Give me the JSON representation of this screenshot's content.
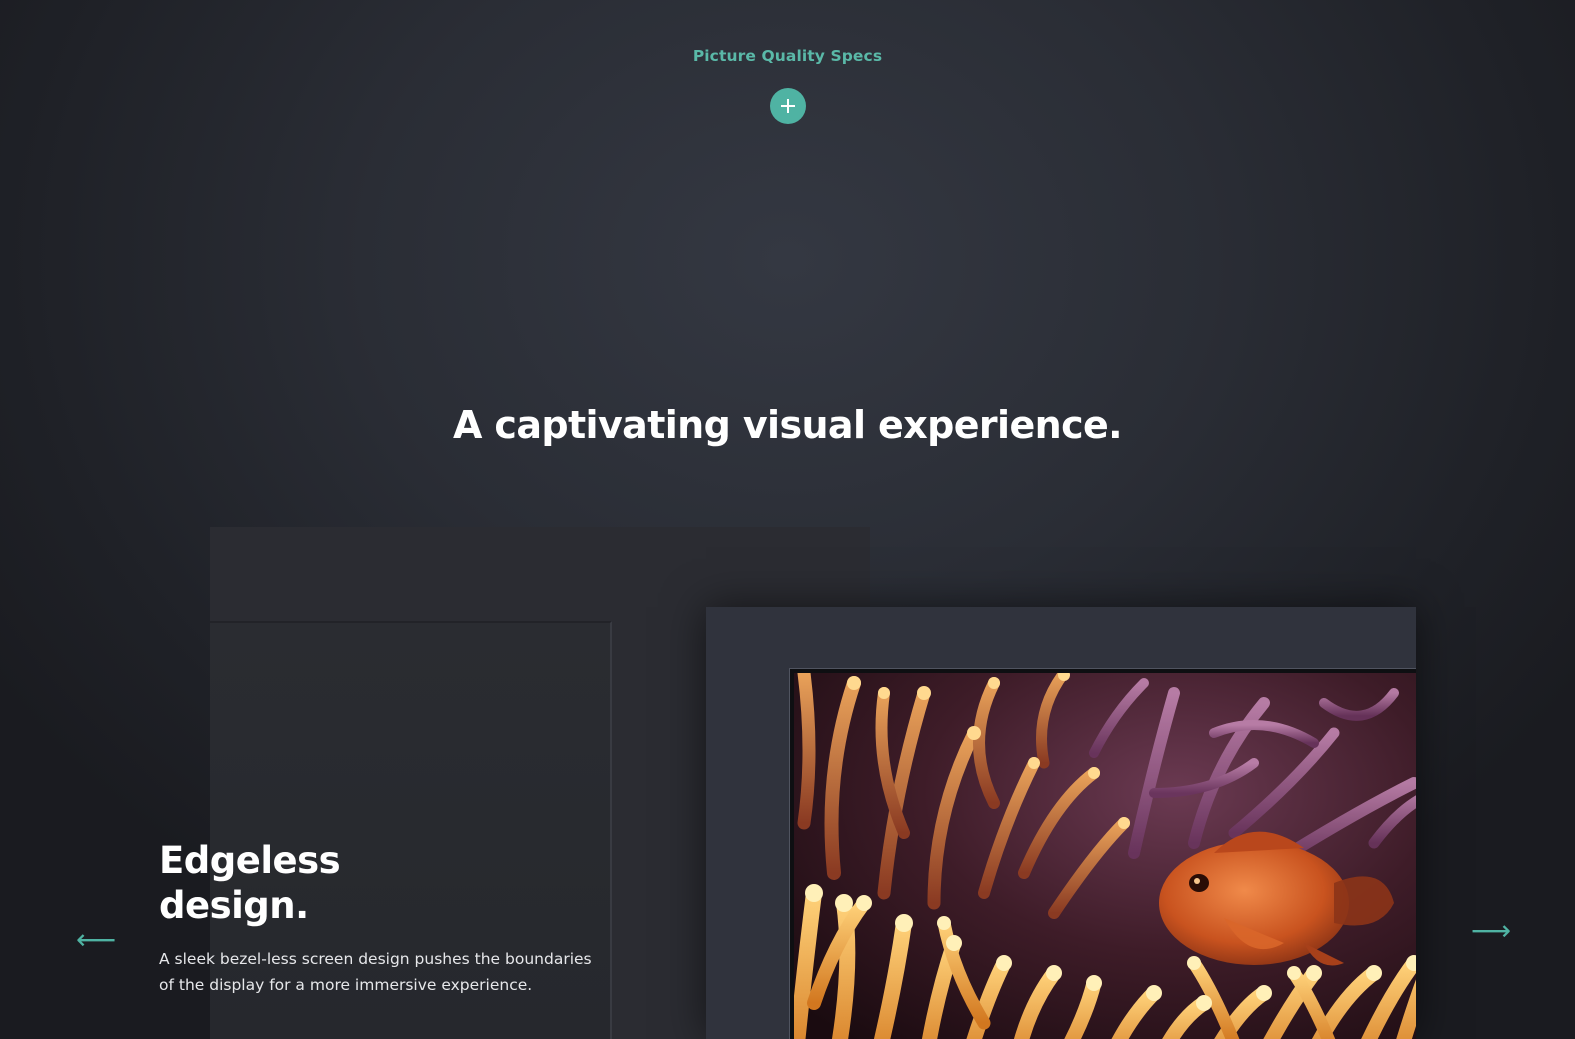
{
  "specs": {
    "label": "Picture Quality Specs",
    "toggle_icon": "plus-icon"
  },
  "section": {
    "headline": "A captivating visual experience."
  },
  "carousel": {
    "slides": [
      {
        "title_line1": "Edgeless",
        "title_line2": "design.",
        "description": "A sleek bezel-less screen design pushes the boundaries of the display for a more immersive experience.",
        "image": "clownfish-in-sea-anemone"
      }
    ],
    "prev_icon": "arrow-left-icon",
    "next_icon": "arrow-right-icon",
    "prev_symbol": "⟵",
    "next_symbol": "⟶"
  },
  "colors": {
    "accent": "#4fb3a3",
    "background": "#2a2d35",
    "text": "#ffffff"
  }
}
